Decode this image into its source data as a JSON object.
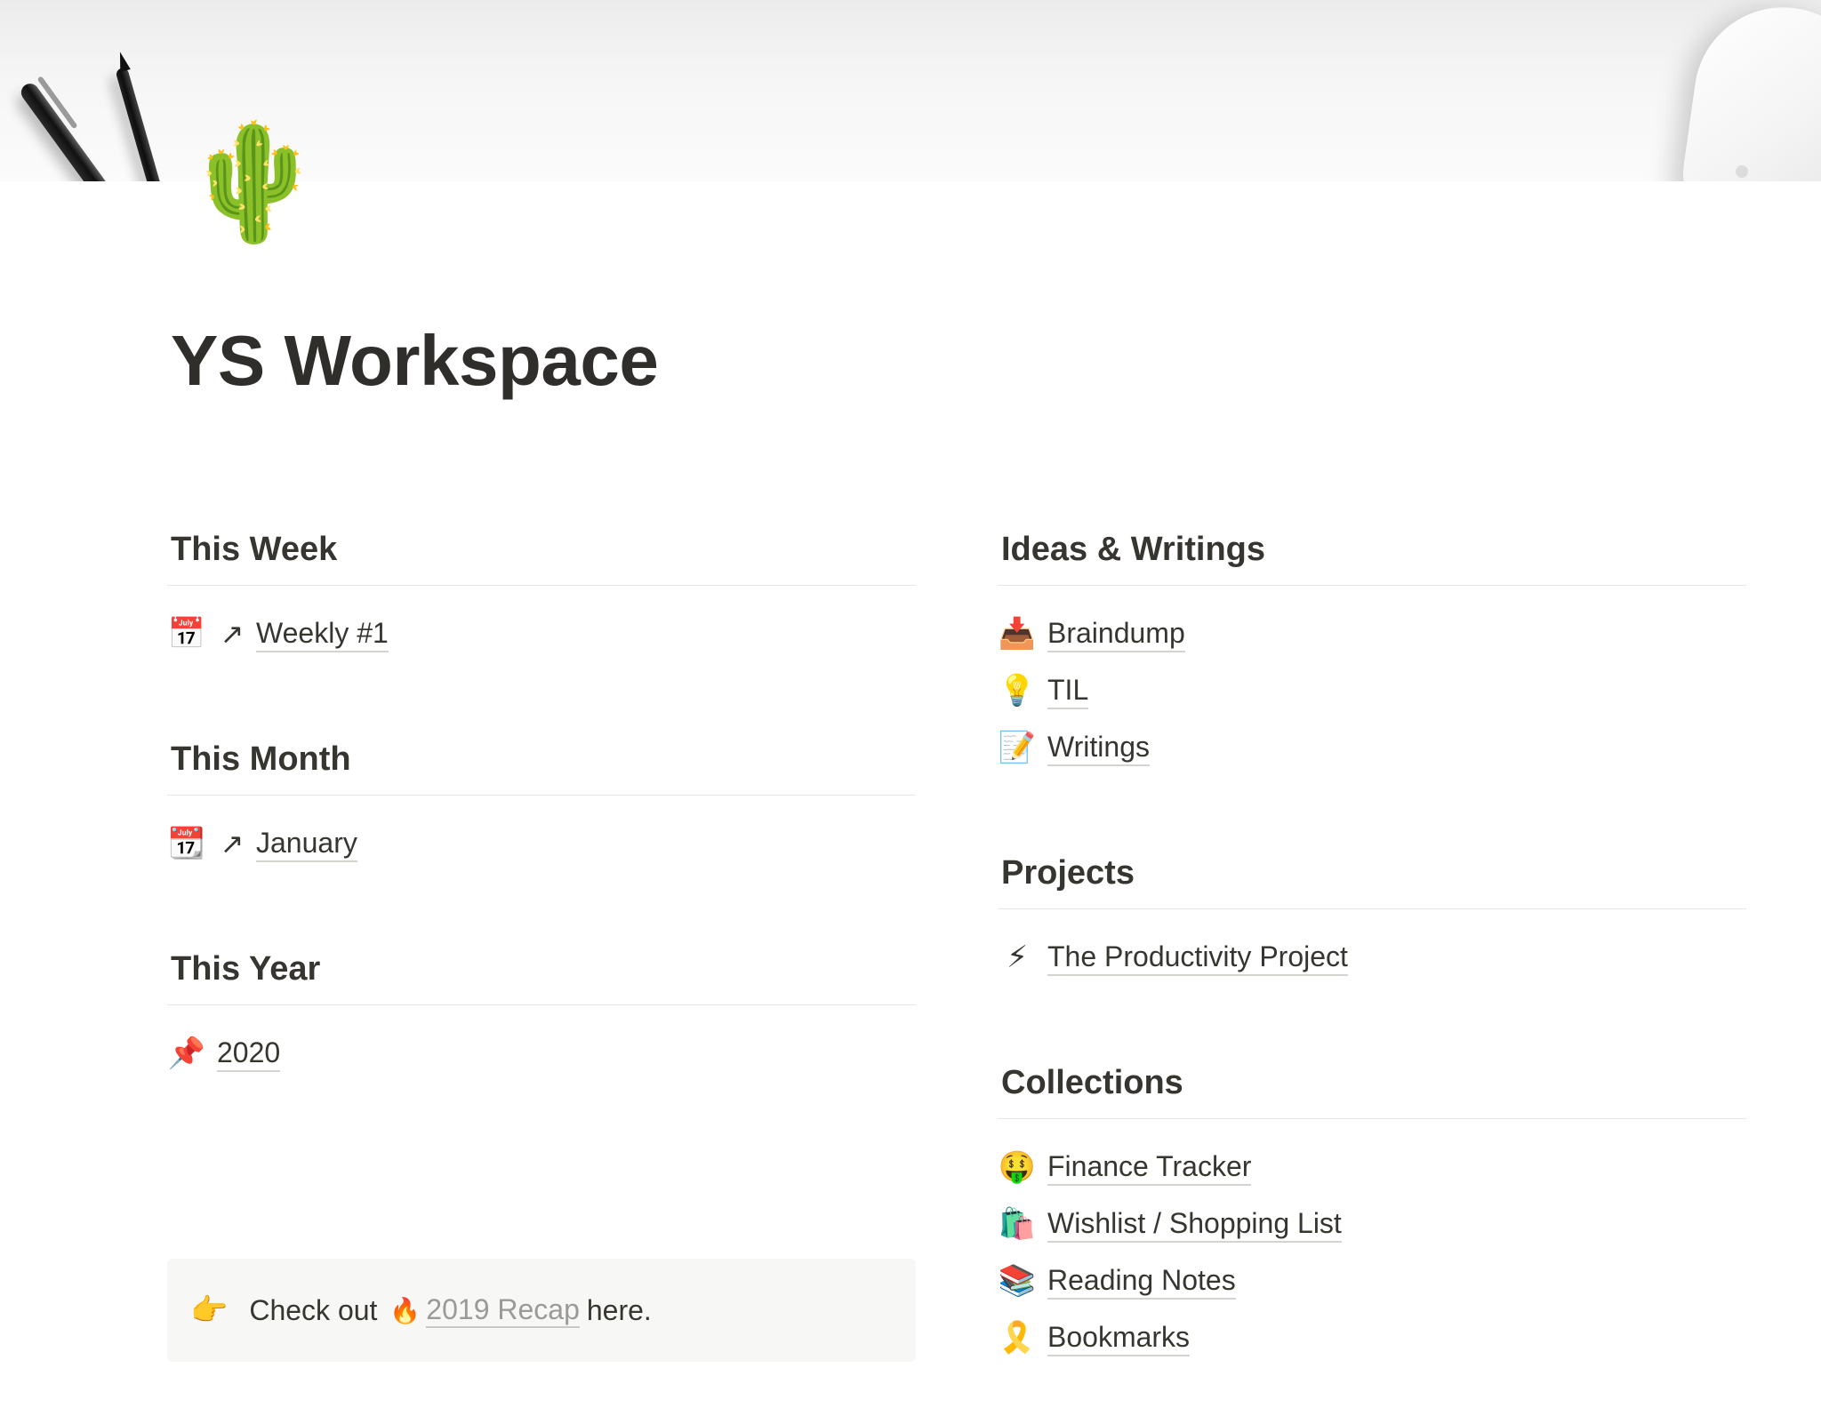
{
  "page": {
    "icon": "🌵",
    "title": "YS Workspace"
  },
  "left_sections": [
    {
      "heading": "This Week",
      "items": [
        {
          "icon": "📅",
          "arrow": "↗",
          "label": "Weekly #1"
        }
      ]
    },
    {
      "heading": "This Month",
      "items": [
        {
          "icon": "📆",
          "arrow": "↗",
          "label": "January"
        }
      ]
    },
    {
      "heading": "This Year",
      "items": [
        {
          "icon": "📌",
          "label": "2020"
        }
      ]
    }
  ],
  "right_sections": [
    {
      "heading": "Ideas & Writings",
      "items": [
        {
          "icon": "📥",
          "label": "Braindump"
        },
        {
          "icon": "💡",
          "label": "TIL"
        },
        {
          "icon": "📝",
          "label": "Writings"
        }
      ]
    },
    {
      "heading": "Projects",
      "items": [
        {
          "icon": "⚡",
          "label": "The Productivity Project"
        }
      ]
    },
    {
      "heading": "Collections",
      "items": [
        {
          "icon": "🤑",
          "label": "Finance Tracker"
        },
        {
          "icon": "🛍️",
          "label": "Wishlist / Shopping List"
        },
        {
          "icon": "📚",
          "label": "Reading Notes"
        },
        {
          "icon": "🎗️",
          "label": "Bookmarks"
        }
      ]
    }
  ],
  "callout": {
    "icon": "👉",
    "prefix": "Check out",
    "link_icon": "🔥",
    "link_label": "2019 Recap",
    "suffix": "here."
  }
}
